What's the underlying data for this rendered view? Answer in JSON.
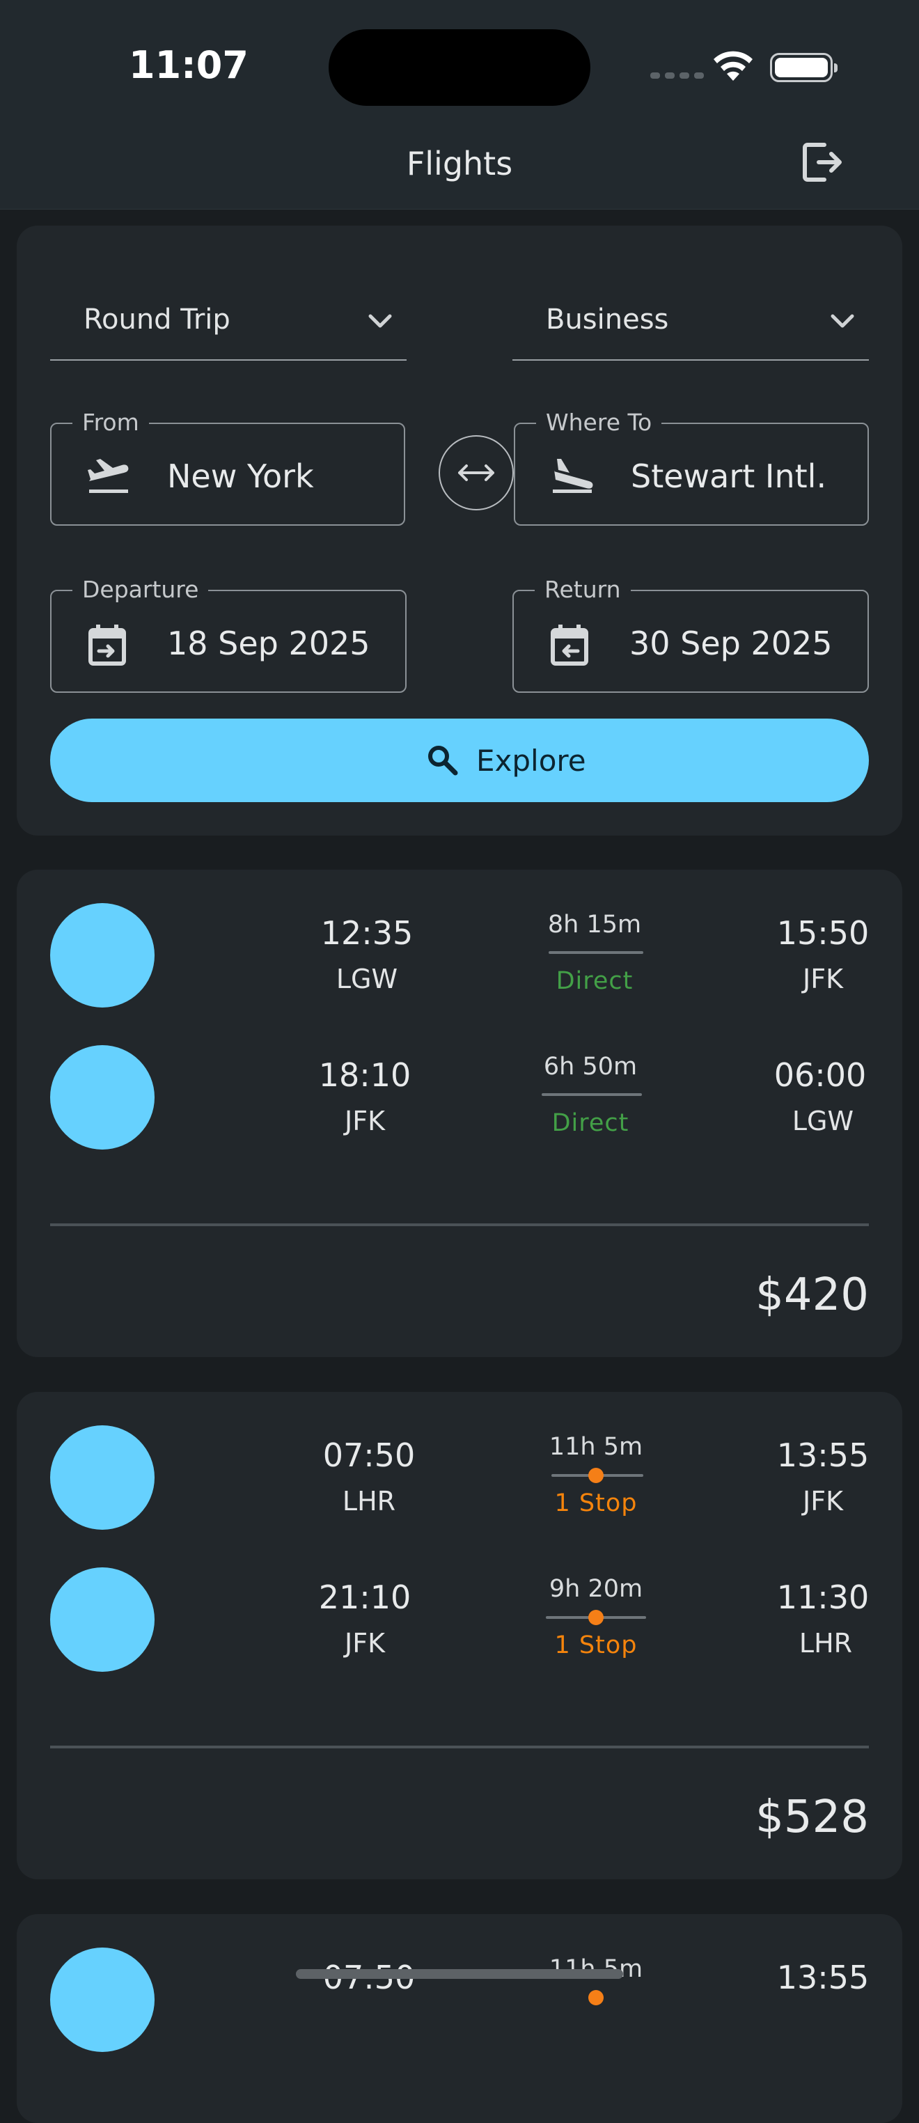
{
  "status_bar": {
    "time": "11:07"
  },
  "app_bar": {
    "title": "Flights",
    "action_icon": "logout-icon"
  },
  "search": {
    "trip_type": "Round Trip",
    "cabin_class": "Business",
    "from": {
      "label": "From",
      "value": "New York",
      "icon": "flight-takeoff-icon"
    },
    "to": {
      "label": "Where To",
      "value": "Stewart Intl.",
      "icon": "flight-land-icon"
    },
    "departure": {
      "label": "Departure",
      "value": "18 Sep 2025",
      "icon": "calendar-depart-icon"
    },
    "return": {
      "label": "Return",
      "value": "30 Sep 2025",
      "icon": "calendar-return-icon"
    },
    "explore_label": "Explore"
  },
  "results": [
    {
      "price": "$420",
      "legs": [
        {
          "dep_time": "12:35",
          "dep_code": "LGW",
          "duration": "8h 15m",
          "stops": "Direct",
          "arr_time": "15:50",
          "arr_code": "JFK"
        },
        {
          "dep_time": "18:10",
          "dep_code": "JFK",
          "duration": "6h 50m",
          "stops": "Direct",
          "arr_time": "06:00",
          "arr_code": "LGW"
        }
      ]
    },
    {
      "price": "$528",
      "legs": [
        {
          "dep_time": "07:50",
          "dep_code": "LHR",
          "duration": "11h 5m",
          "stops": "1 Stop",
          "arr_time": "13:55",
          "arr_code": "JFK"
        },
        {
          "dep_time": "21:10",
          "dep_code": "JFK",
          "duration": "9h 20m",
          "stops": "1 Stop",
          "arr_time": "11:30",
          "arr_code": "LHR"
        }
      ]
    },
    {
      "legs": [
        {
          "dep_time": "07:50",
          "duration": "11h 5m",
          "arr_time": "13:55"
        }
      ]
    }
  ],
  "colors": {
    "accent": "#66d1fe",
    "direct": "#43a047",
    "stop": "#f5840c"
  }
}
